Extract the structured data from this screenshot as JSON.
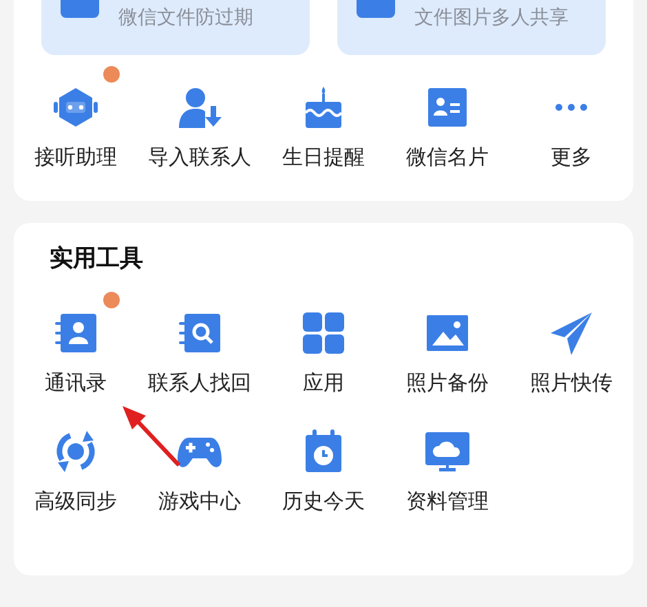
{
  "top_tiles": [
    {
      "subtitle": "微信文件防过期"
    },
    {
      "subtitle": "文件图片多人共享"
    }
  ],
  "quick_items": [
    {
      "label": "接听助理",
      "kind": "robot",
      "badge": true
    },
    {
      "label": "导入联系人",
      "kind": "import",
      "badge": false
    },
    {
      "label": "生日提醒",
      "kind": "cake",
      "badge": false
    },
    {
      "label": "微信名片",
      "kind": "card",
      "badge": false
    },
    {
      "label": "更多",
      "kind": "more",
      "badge": false
    }
  ],
  "tools": {
    "title": "实用工具",
    "items": [
      {
        "label": "通讯录",
        "kind": "contacts",
        "badge": true
      },
      {
        "label": "联系人找回",
        "kind": "find",
        "badge": false
      },
      {
        "label": "应用",
        "kind": "apps",
        "badge": false
      },
      {
        "label": "照片备份",
        "kind": "photo",
        "badge": false
      },
      {
        "label": "照片快传",
        "kind": "send",
        "badge": false
      },
      {
        "label": "高级同步",
        "kind": "sync",
        "badge": false
      },
      {
        "label": "游戏中心",
        "kind": "game",
        "badge": false
      },
      {
        "label": "历史今天",
        "kind": "calendar",
        "badge": false
      },
      {
        "label": "资料管理",
        "kind": "cloud",
        "badge": false
      }
    ]
  }
}
